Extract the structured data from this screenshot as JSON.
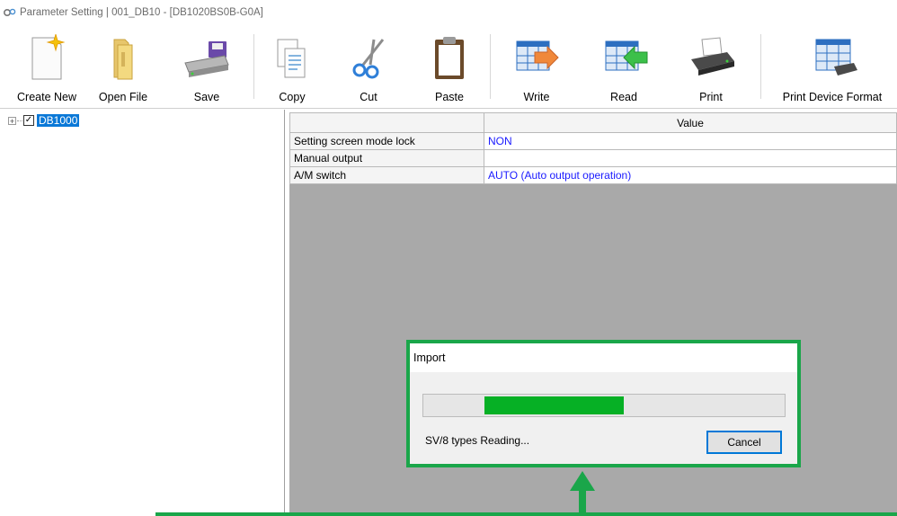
{
  "window": {
    "title": "Parameter Setting  | 001_DB10 - [DB1020BS0B-G0A]"
  },
  "toolbar": {
    "create_new": "Create New",
    "open_file": "Open File",
    "save": "Save",
    "copy": "Copy",
    "cut": "Cut",
    "paste": "Paste",
    "write": "Write",
    "read": "Read",
    "print": "Print",
    "print_device_format": "Print Device Format"
  },
  "tree": {
    "expander": "+",
    "checked": true,
    "check_mark": "✓",
    "node_label": "DB1000"
  },
  "grid": {
    "header_value": "Value",
    "rows": [
      {
        "name": "Setting screen mode lock",
        "value": "NON"
      },
      {
        "name": "Manual output",
        "value": ""
      },
      {
        "name": "A/M switch",
        "value": "AUTO (Auto output operation)"
      }
    ]
  },
  "dialog": {
    "title": "Import",
    "progress_start": 0.17,
    "progress_end": 0.555,
    "status": "SV/8 types Reading...",
    "cancel": "Cancel"
  },
  "colors": {
    "highlight": "#1aa64a",
    "progress": "#06b025",
    "value_text": "#1a1aff",
    "selection": "#0a78d7"
  }
}
